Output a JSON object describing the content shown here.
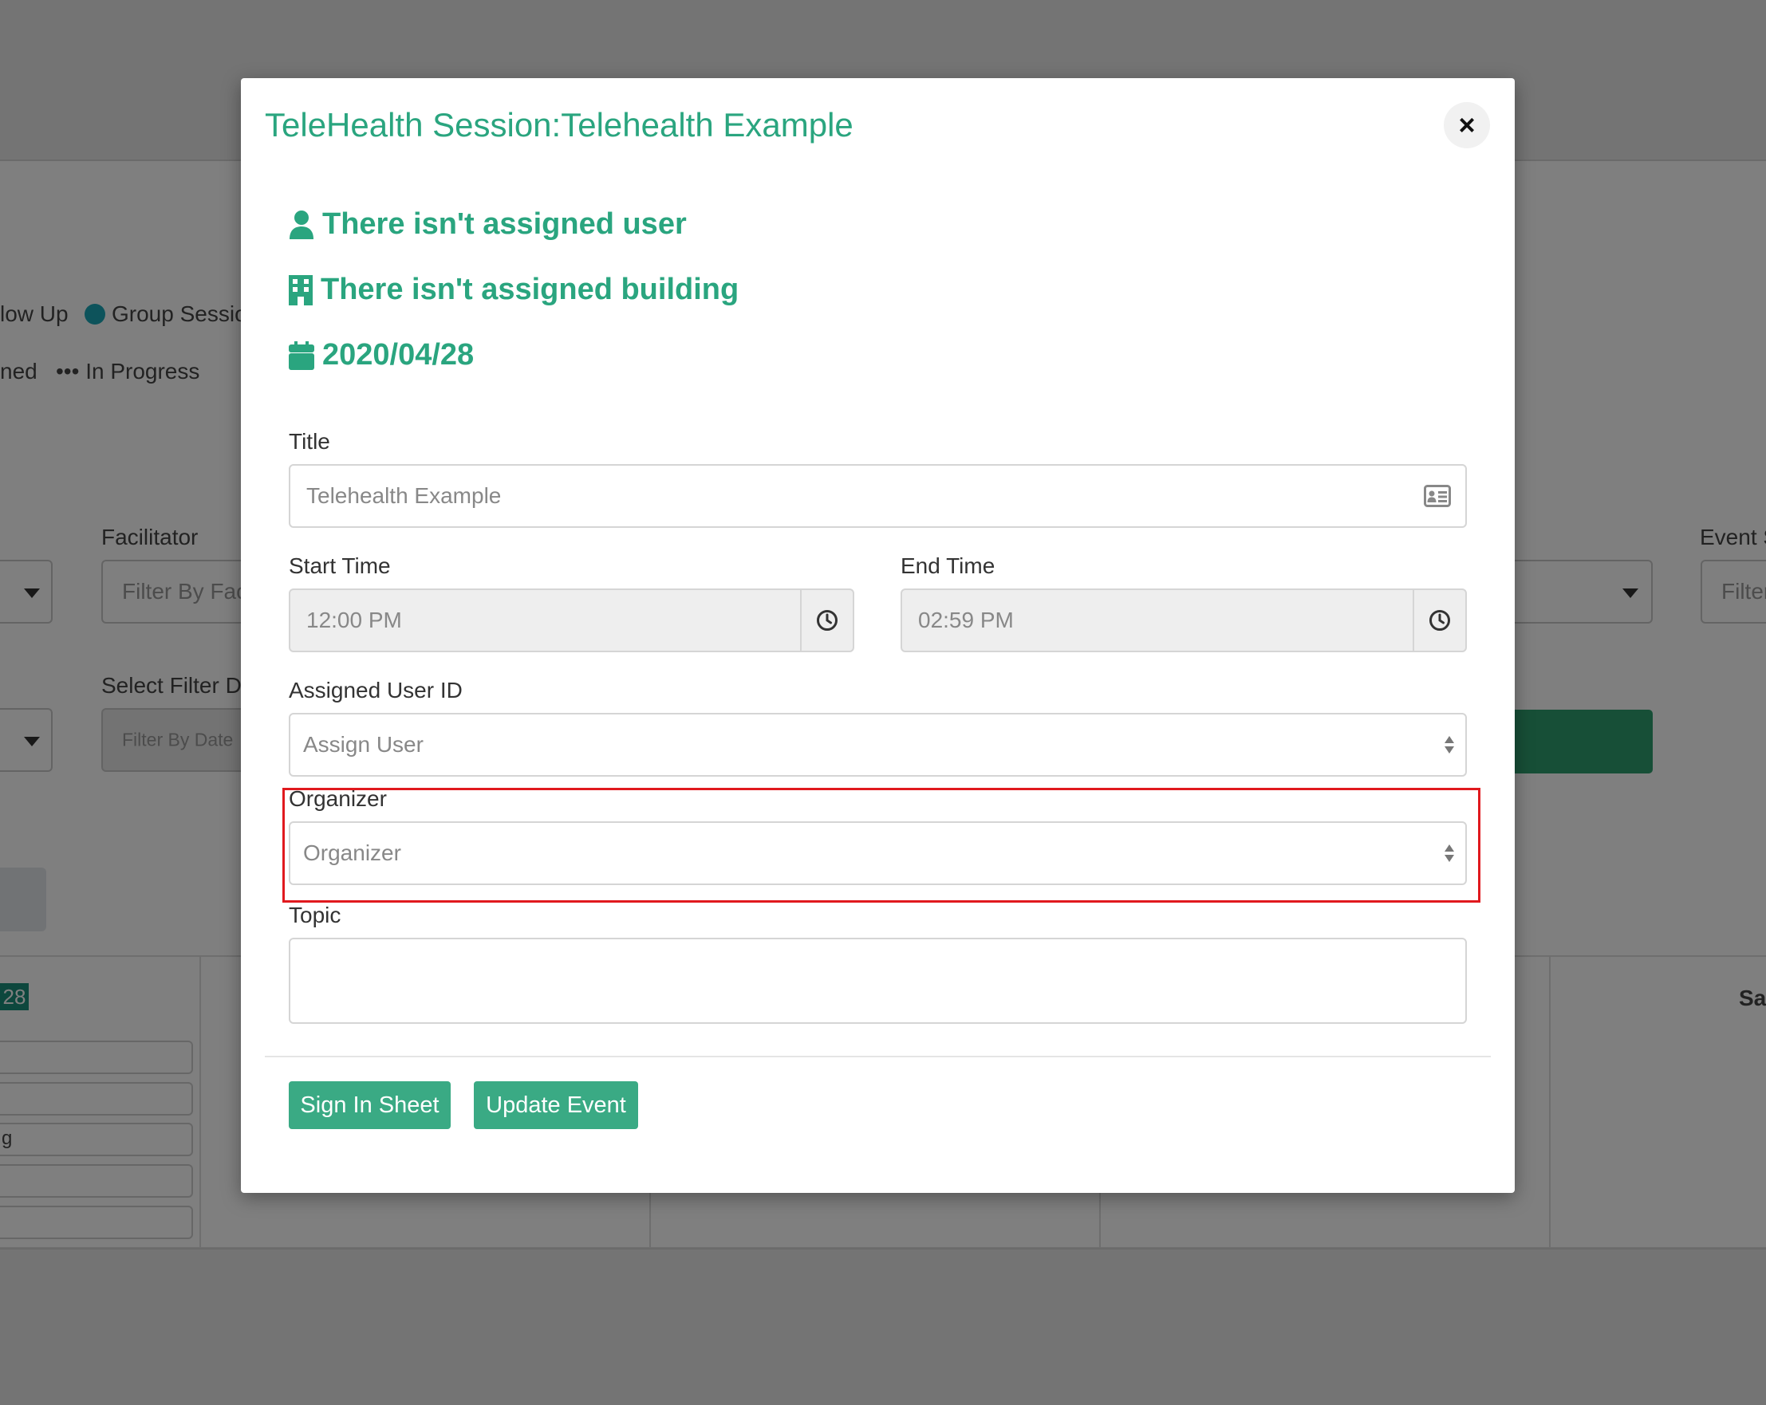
{
  "background": {
    "legend_row1": {
      "item1": "low Up",
      "item2": "Group Sessio"
    },
    "legend_row2": {
      "item1": "ned",
      "item2": "••• In Progress"
    },
    "facilitator_label": "Facilitator",
    "facilitator_placeholder": "Filter By Fac",
    "select_filter_label": "Select Filter Da",
    "date_placeholder": "Filter By Date",
    "event_label": "Event S",
    "event_placeholder": "Filter",
    "day_badge": "28",
    "day_header_right": "Sa",
    "event_snippet": "g"
  },
  "modal": {
    "title": "TeleHealth Session:Telehealth Example",
    "close_glyph": "×",
    "assigned_user_text": "There isn't assigned user",
    "assigned_building_text": "There isn't assigned building",
    "date_text": "2020/04/28",
    "fields": {
      "title_label": "Title",
      "title_value": "Telehealth Example",
      "start_time_label": "Start Time",
      "start_time_value": "12:00 PM",
      "end_time_label": "End Time",
      "end_time_value": "02:59 PM",
      "assigned_user_label": "Assigned User ID",
      "assigned_user_placeholder": "Assign User",
      "organizer_label": "Organizer",
      "organizer_placeholder": "Organizer",
      "topic_label": "Topic",
      "topic_value": ""
    },
    "buttons": {
      "sign_in_sheet": "Sign In Sheet",
      "update_event": "Update Event"
    }
  },
  "colors": {
    "accent": "#2aa57f",
    "button": "#3aaa84",
    "highlight": "#e0191e",
    "overlay": "rgba(0,0,0,0.5)"
  },
  "icons": [
    "user-icon",
    "building-icon",
    "calendar-icon",
    "id-card-icon",
    "clock-icon",
    "close-icon",
    "select-arrows-icon"
  ]
}
